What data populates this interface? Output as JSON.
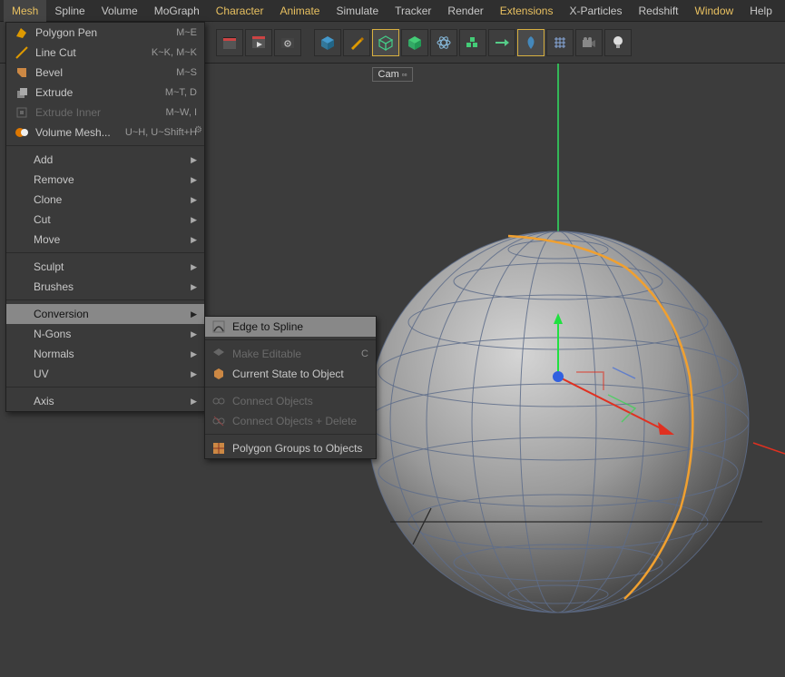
{
  "menubar": {
    "items": [
      {
        "label": "Mesh",
        "highlight": true,
        "open": true
      },
      {
        "label": "Spline"
      },
      {
        "label": "Volume"
      },
      {
        "label": "MoGraph"
      },
      {
        "label": "Character",
        "highlight": true
      },
      {
        "label": "Animate",
        "highlight": true
      },
      {
        "label": "Simulate"
      },
      {
        "label": "Tracker"
      },
      {
        "label": "Render"
      },
      {
        "label": "Extensions",
        "highlight": true
      },
      {
        "label": "X-Particles"
      },
      {
        "label": "Redshift"
      },
      {
        "label": "Window",
        "highlight": true
      },
      {
        "label": "Help"
      }
    ]
  },
  "toolbar": {
    "groups": [
      [
        "clapper",
        "play-clapper",
        "gear"
      ],
      [
        "cube",
        "brush",
        "wire-cube",
        "solid-cube",
        "atom",
        "cubes",
        "arrow-right",
        "leaf",
        "grid",
        "eyes",
        "bulb"
      ]
    ],
    "activeIndexes": {
      "1": [
        2,
        7
      ]
    }
  },
  "viewport": {
    "label": "Cam"
  },
  "mesh_menu": {
    "section1": [
      {
        "icon": "polygon-pen",
        "label": "Polygon Pen",
        "shortcut": "M~E"
      },
      {
        "icon": "line-cut",
        "label": "Line Cut",
        "shortcut": "K~K, M~K"
      },
      {
        "icon": "bevel",
        "label": "Bevel",
        "shortcut": "M~S"
      },
      {
        "icon": "extrude",
        "label": "Extrude",
        "shortcut": "M~T, D"
      },
      {
        "icon": "extrude-inner",
        "label": "Extrude Inner",
        "shortcut": "M~W, I",
        "disabled": true
      },
      {
        "icon": "volume-mesh",
        "label": "Volume Mesh...",
        "shortcut": "U~H, U~Shift+H",
        "gear": true
      }
    ],
    "section2": [
      {
        "label": "Add",
        "submenu": true
      },
      {
        "label": "Remove",
        "submenu": true
      },
      {
        "label": "Clone",
        "submenu": true
      },
      {
        "label": "Cut",
        "submenu": true
      },
      {
        "label": "Move",
        "submenu": true
      }
    ],
    "section3": [
      {
        "label": "Sculpt",
        "submenu": true
      },
      {
        "label": "Brushes",
        "submenu": true
      }
    ],
    "section4": [
      {
        "label": "Conversion",
        "submenu": true,
        "highlighted": true
      },
      {
        "label": "N-Gons",
        "submenu": true
      },
      {
        "label": "Normals",
        "submenu": true
      },
      {
        "label": "UV",
        "submenu": true
      }
    ],
    "section5": [
      {
        "label": "Axis",
        "submenu": true
      }
    ]
  },
  "conversion_submenu": {
    "items": [
      {
        "icon": "edge-spline",
        "label": "Edge to Spline",
        "highlighted": true
      },
      {
        "sep": true
      },
      {
        "icon": "make-editable",
        "label": "Make Editable",
        "shortcut": "C",
        "disabled": true
      },
      {
        "icon": "current-state",
        "label": "Current State to Object"
      },
      {
        "sep": true
      },
      {
        "icon": "connect",
        "label": "Connect Objects",
        "disabled": true
      },
      {
        "icon": "connect-del",
        "label": "Connect Objects + Delete",
        "disabled": true
      },
      {
        "sep": true
      },
      {
        "icon": "poly-groups",
        "label": "Polygon Groups to Objects"
      }
    ]
  },
  "colors": {
    "accent": "#e8a030",
    "edge_highlight": "#f0a030"
  }
}
